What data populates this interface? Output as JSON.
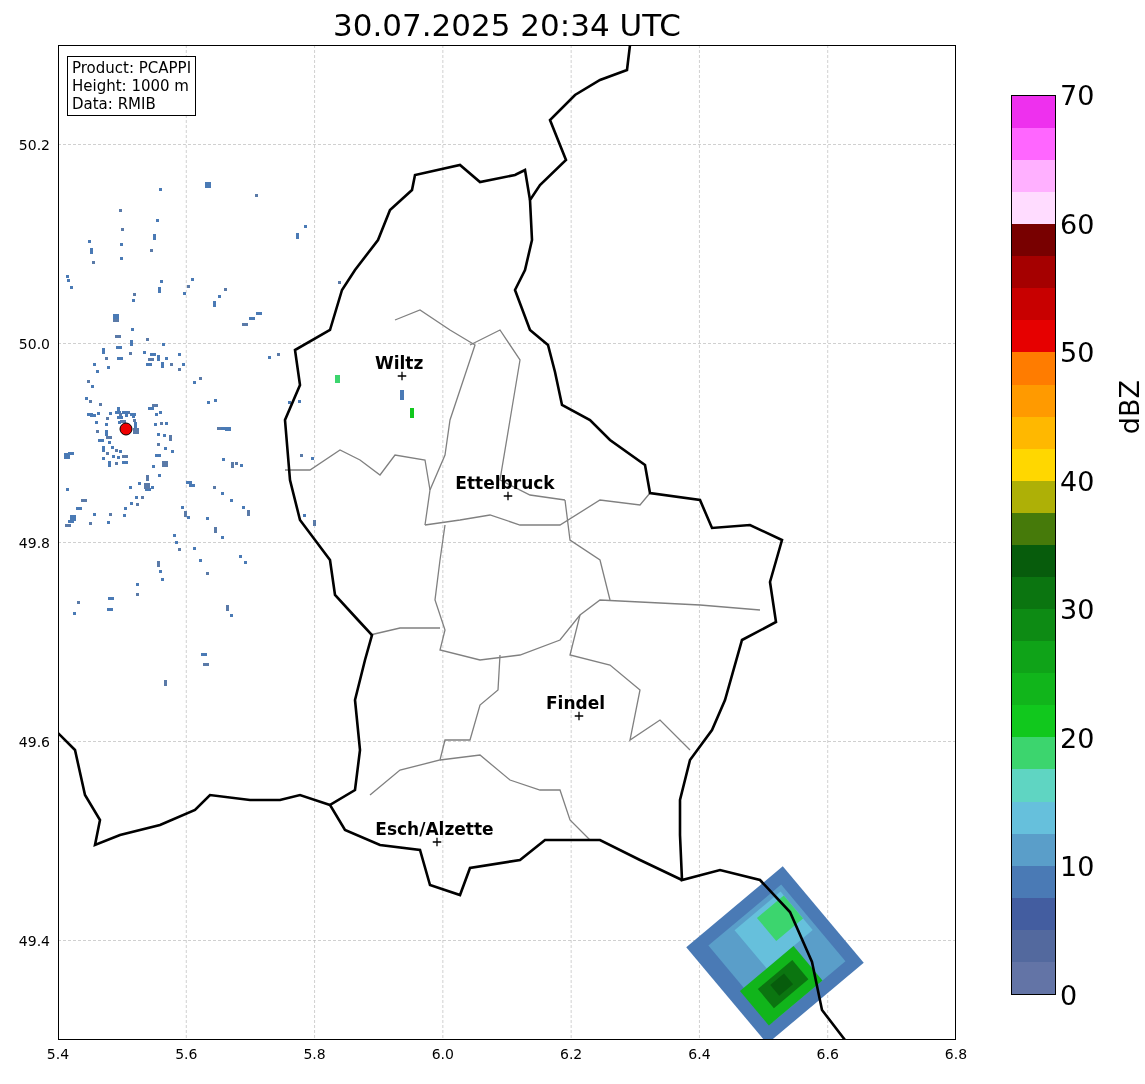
{
  "title": "30.07.2025 20:34 UTC",
  "info_box": [
    "Product: PCAPPI",
    "Height: 1000 m",
    "Data: RMIB"
  ],
  "x_ticks": [
    "5.4",
    "5.6",
    "5.8",
    "6.0",
    "6.2",
    "6.4",
    "6.6",
    "6.8"
  ],
  "y_ticks": [
    "50.2",
    "50.0",
    "49.8",
    "49.6",
    "49.4"
  ],
  "cities": [
    {
      "name": "Wiltz"
    },
    {
      "name": "Ettelbruck"
    },
    {
      "name": "Findel"
    },
    {
      "name": "Esch/Alzette"
    }
  ],
  "colorbar": {
    "label": "dBZ",
    "ticks": [
      "70",
      "60",
      "50",
      "40",
      "30",
      "20",
      "10",
      "0"
    ],
    "segments": [
      {
        "color": "#6374a6"
      },
      {
        "color": "#53699e"
      },
      {
        "color": "#435da0"
      },
      {
        "color": "#4a7ab5"
      },
      {
        "color": "#5a9ec9"
      },
      {
        "color": "#66c0dc"
      },
      {
        "color": "#5fd5c2"
      },
      {
        "color": "#3cd56e"
      },
      {
        "color": "#11c81d"
      },
      {
        "color": "#11b51b"
      },
      {
        "color": "#0fa318"
      },
      {
        "color": "#0d8b14"
      },
      {
        "color": "#0b7510"
      },
      {
        "color": "#075c0c"
      },
      {
        "color": "#467a0a"
      },
      {
        "color": "#aeb006"
      },
      {
        "color": "#ffd700"
      },
      {
        "color": "#ffb800"
      },
      {
        "color": "#ff9a00"
      },
      {
        "color": "#ff7c00"
      },
      {
        "color": "#e60000"
      },
      {
        "color": "#c80000"
      },
      {
        "color": "#a50000"
      },
      {
        "color": "#780000"
      },
      {
        "color": "#ffdcff"
      },
      {
        "color": "#ffb0ff"
      },
      {
        "color": "#ff66ff"
      },
      {
        "color": "#ee30ee"
      }
    ]
  }
}
